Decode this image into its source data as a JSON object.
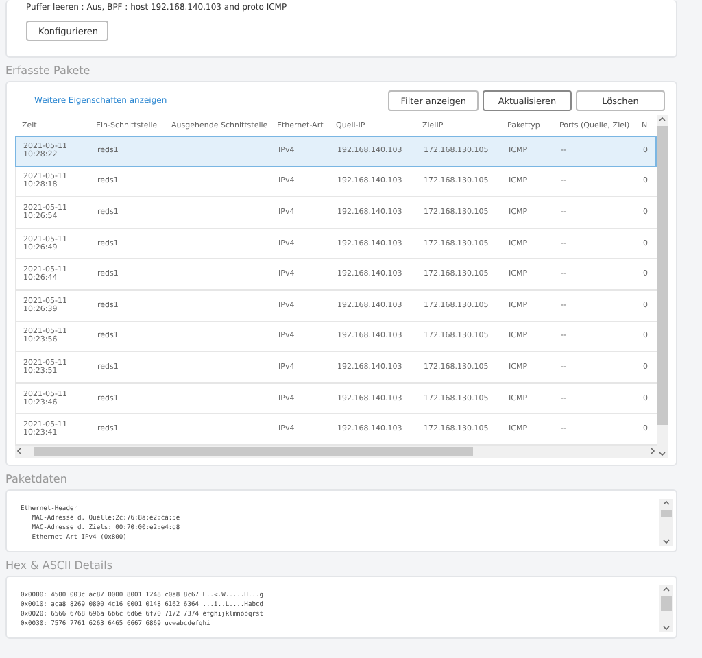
{
  "capture_settings": {
    "summary": "Puffer leeren : Aus, BPF : host 192.168.140.103 and proto ICMP",
    "configure_button": "Konfigurieren"
  },
  "captured_packets": {
    "title": "Erfasste Pakete",
    "more_properties_link": "Weitere Eigenschaften anzeigen",
    "buttons": [
      "Filter anzeigen",
      "Aktualisieren",
      "Löschen"
    ],
    "columns": [
      "Zeit",
      "Ein-Schnittstelle",
      "Ausgehende Schnittstelle",
      "Ethernet-Art",
      "Quell-IP",
      "ZielIP",
      "Pakettyp",
      "Ports (Quelle, Ziel)",
      "N"
    ],
    "rows": [
      {
        "selected": true,
        "cells": [
          "2021-05-11 10:28:22",
          "reds1",
          "",
          "IPv4",
          "192.168.140.103",
          "172.168.130.105",
          "ICMP",
          "--",
          "0"
        ]
      },
      {
        "selected": false,
        "cells": [
          "2021-05-11 10:28:18",
          "reds1",
          "",
          "IPv4",
          "192.168.140.103",
          "172.168.130.105",
          "ICMP",
          "--",
          "0"
        ]
      },
      {
        "selected": false,
        "cells": [
          "2021-05-11 10:26:54",
          "reds1",
          "",
          "IPv4",
          "192.168.140.103",
          "172.168.130.105",
          "ICMP",
          "--",
          "0"
        ]
      },
      {
        "selected": false,
        "cells": [
          "2021-05-11 10:26:49",
          "reds1",
          "",
          "IPv4",
          "192.168.140.103",
          "172.168.130.105",
          "ICMP",
          "--",
          "0"
        ]
      },
      {
        "selected": false,
        "cells": [
          "2021-05-11 10:26:44",
          "reds1",
          "",
          "IPv4",
          "192.168.140.103",
          "172.168.130.105",
          "ICMP",
          "--",
          "0"
        ]
      },
      {
        "selected": false,
        "cells": [
          "2021-05-11 10:26:39",
          "reds1",
          "",
          "IPv4",
          "192.168.140.103",
          "172.168.130.105",
          "ICMP",
          "--",
          "0"
        ]
      },
      {
        "selected": false,
        "cells": [
          "2021-05-11 10:23:56",
          "reds1",
          "",
          "IPv4",
          "192.168.140.103",
          "172.168.130.105",
          "ICMP",
          "--",
          "0"
        ]
      },
      {
        "selected": false,
        "cells": [
          "2021-05-11 10:23:51",
          "reds1",
          "",
          "IPv4",
          "192.168.140.103",
          "172.168.130.105",
          "ICMP",
          "--",
          "0"
        ]
      },
      {
        "selected": false,
        "cells": [
          "2021-05-11 10:23:46",
          "reds1",
          "",
          "IPv4",
          "192.168.140.103",
          "172.168.130.105",
          "ICMP",
          "--",
          "0"
        ]
      },
      {
        "selected": false,
        "cells": [
          "2021-05-11 10:23:41",
          "reds1",
          "",
          "IPv4",
          "192.168.140.103",
          "172.168.130.105",
          "ICMP",
          "--",
          "0"
        ]
      }
    ]
  },
  "packet_data": {
    "title": "Paketdaten",
    "lines": [
      "Ethernet-Header",
      "   MAC-Adresse d. Quelle:2c:76:8a:e2:ca:5e",
      "   MAC-Adresse d. Ziels: 00:70:00:e2:e4:d8",
      "   Ethernet-Art IPv4 (0x800)"
    ]
  },
  "hex_details": {
    "title": "Hex & ASCII Details",
    "lines": [
      "0x0000: 4500 003c ac87 0000 8001 1248 c0a8 8c67 E..<.W.....H...g",
      "0x0010: aca8 8269 0800 4c16 0001 0148 6162 6364 ...i..L....Habcd",
      "0x0020: 6566 6768 696a 6b6c 6d6e 6f70 7172 7374 efghijklmnopqrst",
      "0x0030: 7576 7761 6263 6465 6667 6869 uvwabcdefghi"
    ]
  }
}
